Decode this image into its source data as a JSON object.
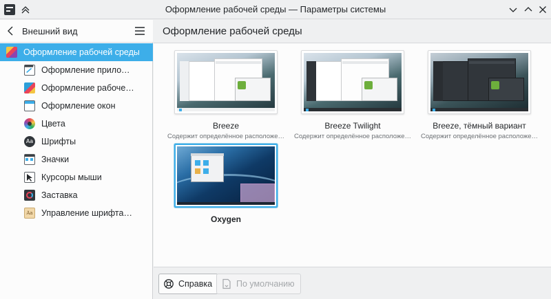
{
  "window": {
    "title": "Оформление рабочей среды — Параметры системы"
  },
  "sidebar": {
    "header_title": "Внешний вид",
    "items": [
      {
        "label": "Оформление рабочей среды",
        "icon": "desktop-theme-icon",
        "active": true
      },
      {
        "label": "Оформление приложен…",
        "icon": "application-style-icon"
      },
      {
        "label": "Оформление рабочего с…",
        "icon": "workspace-theme-icon"
      },
      {
        "label": "Оформление окон",
        "icon": "window-decorations-icon"
      },
      {
        "label": "Цвета",
        "icon": "colors-icon"
      },
      {
        "label": "Шрифты",
        "icon": "fonts-icon"
      },
      {
        "label": "Значки",
        "icon": "icons-icon"
      },
      {
        "label": "Курсоры мыши",
        "icon": "cursors-icon"
      },
      {
        "label": "Заставка",
        "icon": "splash-screen-icon"
      },
      {
        "label": "Управление шрифтами",
        "icon": "font-management-icon"
      }
    ]
  },
  "main": {
    "title": "Оформление рабочей среды",
    "themes": [
      {
        "name": "Breeze",
        "description": "Содержит определённое расположе…",
        "variant": "light",
        "selected": false
      },
      {
        "name": "Breeze Twilight",
        "description": "Содержит определённое расположе…",
        "variant": "twilight",
        "selected": false
      },
      {
        "name": "Breeze, тёмный вариант",
        "description": "Содержит определённое расположе…",
        "variant": "dark",
        "selected": false
      },
      {
        "name": "Oxygen",
        "description": "",
        "variant": "oxygen",
        "selected": true
      }
    ]
  },
  "footer": {
    "help_label": "Справка",
    "defaults_label": "По умолчанию"
  },
  "colors": {
    "accent": "#3daee9",
    "window_bg": "#eff0f1",
    "view_bg": "#fcfcfc"
  }
}
